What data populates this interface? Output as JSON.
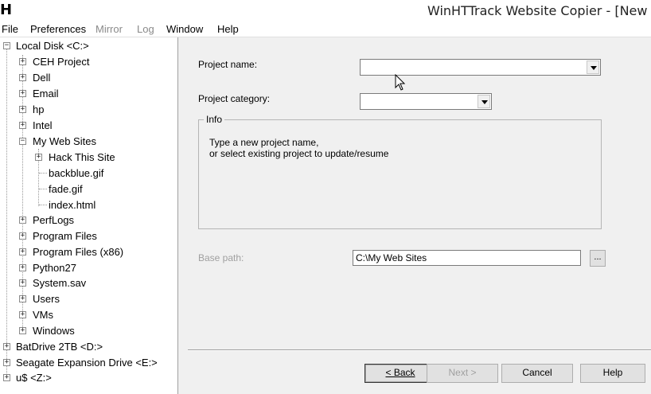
{
  "window": {
    "app_icon": "H",
    "title": "WinHTTrack Website Copier - [New Pr"
  },
  "menu": [
    "File",
    "Preferences",
    "Mirror",
    "Log",
    "Window",
    "Help"
  ],
  "tree": {
    "local_disk": "Local Disk <C:>",
    "ceh_project": "CEH Project",
    "dell": "Dell",
    "email": "Email",
    "hp": "hp",
    "intel": "Intel",
    "my_web_sites": "My Web Sites",
    "hack_this_site": "Hack This Site",
    "backblue": "backblue.gif",
    "fade": "fade.gif",
    "index": "index.html",
    "perflogs": "PerfLogs",
    "program_files": "Program Files",
    "program_files_x86": "Program Files (x86)",
    "python27": "Python27",
    "system_sav": "System.sav",
    "users": "Users",
    "vms": "VMs",
    "windows": "Windows",
    "batdrive": "BatDrive 2TB <D:>",
    "seagate": "Seagate Expansion Drive <E:>",
    "us": "u$ <Z:>"
  },
  "form": {
    "project_name_label": "Project name:",
    "project_name_value": "",
    "project_category_label": "Project category:",
    "project_category_value": "",
    "info_title": "Info",
    "info_line1": "Type a new project name,",
    "info_line2": "or select existing project to update/resume",
    "base_path_label": "Base path:",
    "base_path_value": "C:\\My Web Sites",
    "browse_label": "..."
  },
  "buttons": {
    "back": "< Back",
    "next": "Next >",
    "cancel": "Cancel",
    "help": "Help"
  },
  "icons": {
    "expander": "plus-box-icon",
    "cursor": "mouse-pointer-icon"
  }
}
